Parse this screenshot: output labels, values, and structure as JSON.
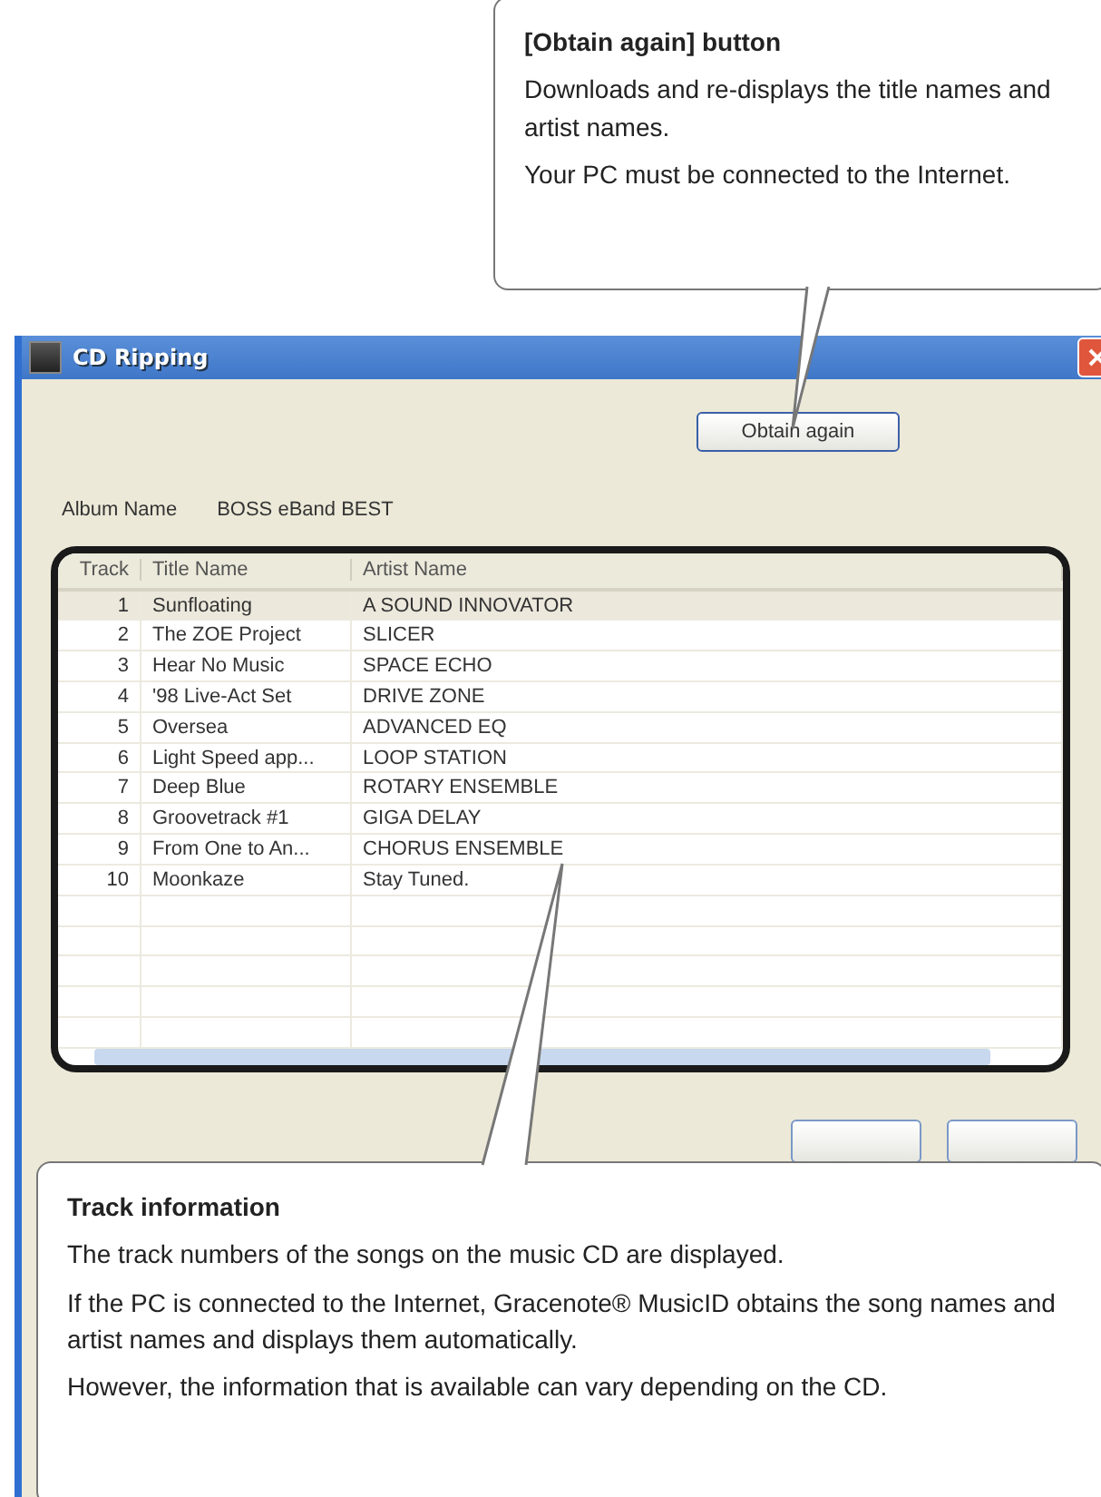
{
  "window": {
    "title": "CD Ripping"
  },
  "obtain_button": "Obtain again",
  "album": {
    "label": "Album Name",
    "value": "BOSS eBand BEST"
  },
  "table": {
    "columns": [
      "Track",
      "Title Name",
      "Artist Name"
    ],
    "rows": [
      {
        "track": "1",
        "title": "Sunfloating",
        "artist": "A SOUND INNOVATOR",
        "selected": true
      },
      {
        "track": "2",
        "title": "The ZOE Project",
        "artist": "SLICER",
        "selected": false
      },
      {
        "track": "3",
        "title": "Hear No Music",
        "artist": "SPACE ECHO",
        "selected": false
      },
      {
        "track": "4",
        "title": "'98 Live-Act Set",
        "artist": "DRIVE ZONE",
        "selected": false
      },
      {
        "track": "5",
        "title": "Oversea",
        "artist": "ADVANCED EQ",
        "selected": false
      },
      {
        "track": "6",
        "title": "Light Speed app...",
        "artist": "LOOP STATION",
        "selected": false
      },
      {
        "track": "7",
        "title": "Deep Blue",
        "artist": "ROTARY ENSEMBLE",
        "selected": false
      },
      {
        "track": "8",
        "title": "Groovetrack #1",
        "artist": "GIGA DELAY",
        "selected": false
      },
      {
        "track": "9",
        "title": "From One to An...",
        "artist": "CHORUS ENSEMBLE",
        "selected": false
      },
      {
        "track": "10",
        "title": "Moonkaze",
        "artist": "Stay Tuned.",
        "selected": false
      }
    ]
  },
  "callouts": [
    {
      "title": "[Obtain again] button",
      "paragraphs": [
        "Downloads and re-displays the title names and artist names.",
        "Your PC must be connected to the Internet."
      ]
    },
    {
      "title": "Track information",
      "paragraphs": [
        "The track numbers of the songs on the music CD are displayed.",
        "If the PC is connected to the Internet, Gracenote® MusicID obtains the song names and artist names and displays them automatically.",
        "However, the information that is available can vary depending on the CD."
      ]
    }
  ]
}
